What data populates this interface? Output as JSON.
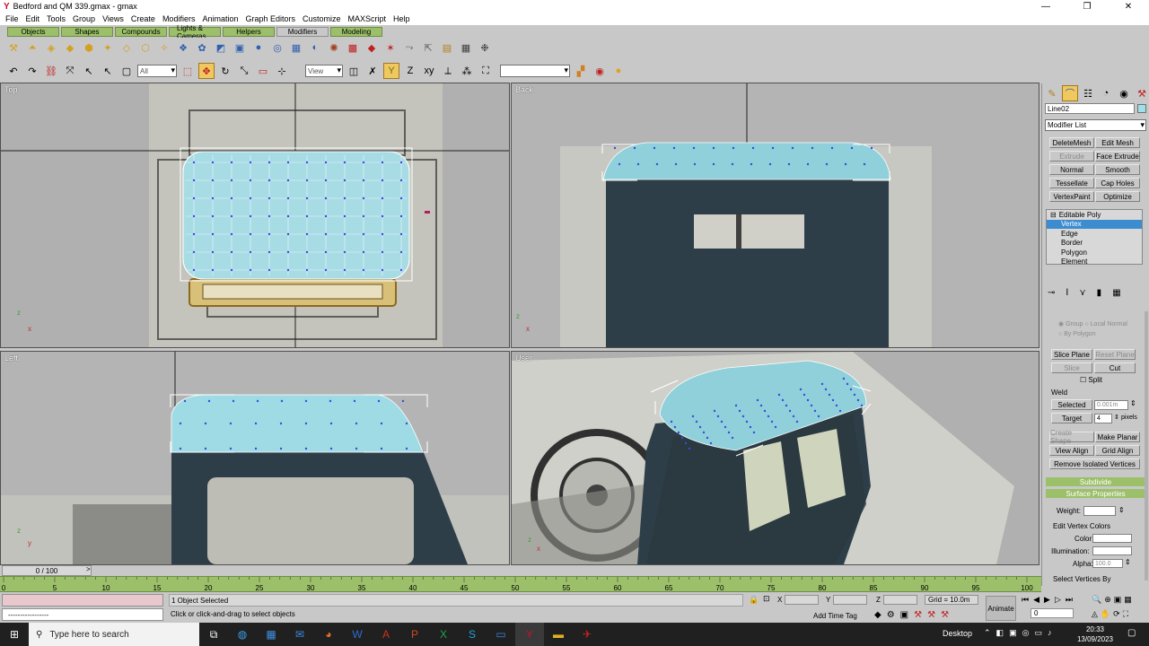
{
  "window": {
    "title": "Bedford and QM 339.gmax - gmax",
    "minimize": "—",
    "maximize": "❐",
    "close": "✕"
  },
  "menu": [
    "File",
    "Edit",
    "Tools",
    "Group",
    "Views",
    "Create",
    "Modifiers",
    "Animation",
    "Graph Editors",
    "Customize",
    "MAXScript",
    "Help"
  ],
  "tabs": [
    {
      "label": "Objects",
      "active": false
    },
    {
      "label": "Shapes",
      "active": false
    },
    {
      "label": "Compounds",
      "active": false
    },
    {
      "label": "Lights & Cameras",
      "active": false
    },
    {
      "label": "Helpers",
      "active": false
    },
    {
      "label": "Modifiers",
      "active": true
    },
    {
      "label": "Modeling",
      "active": false
    }
  ],
  "toolbar2": {
    "filter_value": "All",
    "refcoord_value": "View",
    "named_sel_value": ""
  },
  "viewports": {
    "top": {
      "label": "Top"
    },
    "back": {
      "label": "Back"
    },
    "left": {
      "label": "Left"
    },
    "user": {
      "label": "User"
    }
  },
  "command_panel": {
    "object_name": "Line02",
    "modifier_list": "Modifier List",
    "mod_buttons": [
      [
        "DeleteMesh",
        "Edit Mesh"
      ],
      [
        "Extrude",
        "Face Extrude"
      ],
      [
        "Normal",
        "Smooth"
      ],
      [
        "Tessellate",
        "Cap Holes"
      ],
      [
        "VertexPaint",
        "Optimize"
      ]
    ],
    "stack": {
      "root": "Editable Poly",
      "items": [
        "Vertex",
        "Edge",
        "Border",
        "Polygon",
        "Element"
      ],
      "selected": "Vertex"
    },
    "options": {
      "by": "Group",
      "local_normal": "Local Normal",
      "by_polygon": "By Polygon"
    },
    "slice_plane": "Slice Plane",
    "reset_plane": "Reset Plane",
    "slice": "Slice",
    "cut": "Cut",
    "split": "Split",
    "weld_label": "Weld",
    "weld_selected": "Selected",
    "weld_value": "0.001m",
    "target_label": "Target",
    "target_value": "4",
    "pixels": "pixels",
    "create_shape": "Create Shape",
    "make_planar": "Make Planar",
    "view_align": "View Align",
    "grid_align": "Grid Align",
    "remove_isolated": "Remove Isolated Vertices",
    "subdivide": "Subdivide",
    "surface_properties": "Surface Properties",
    "weight_label": "Weight:",
    "edit_vertex_colors": "Edit Vertex Colors",
    "color_label": "Color:",
    "illumination_label": "Illumination:",
    "alpha_label": "Alpha:",
    "alpha_value": "100.0",
    "select_vertices_by": "Select Vertices By"
  },
  "timeline": {
    "frame": "0 / 100",
    "ticks": [
      "0",
      "5",
      "10",
      "15",
      "20",
      "25",
      "30",
      "35",
      "40",
      "45",
      "50",
      "55",
      "60",
      "65",
      "70",
      "75",
      "80",
      "85",
      "90",
      "95",
      "100"
    ]
  },
  "status": {
    "selection": "1 Object Selected",
    "prompt": "Click or click-and-drag to select objects",
    "script_line": "-----------------",
    "x_label": "X",
    "y_label": "Y",
    "z_label": "Z",
    "grid": "Grid = 10.0m",
    "add_time_tag": "Add Time Tag",
    "animate": "Animate",
    "frame_field": "0"
  },
  "taskbar": {
    "search": "Type here to search",
    "desktop": "Desktop",
    "time": "20:33",
    "date": "13/09/2023"
  },
  "colors": {
    "accent_green": "#9cc06a",
    "selection_blue": "#3c8cd0",
    "mesh_cyan": "#9fe0e8",
    "cab_dark": "#2e3e48"
  }
}
